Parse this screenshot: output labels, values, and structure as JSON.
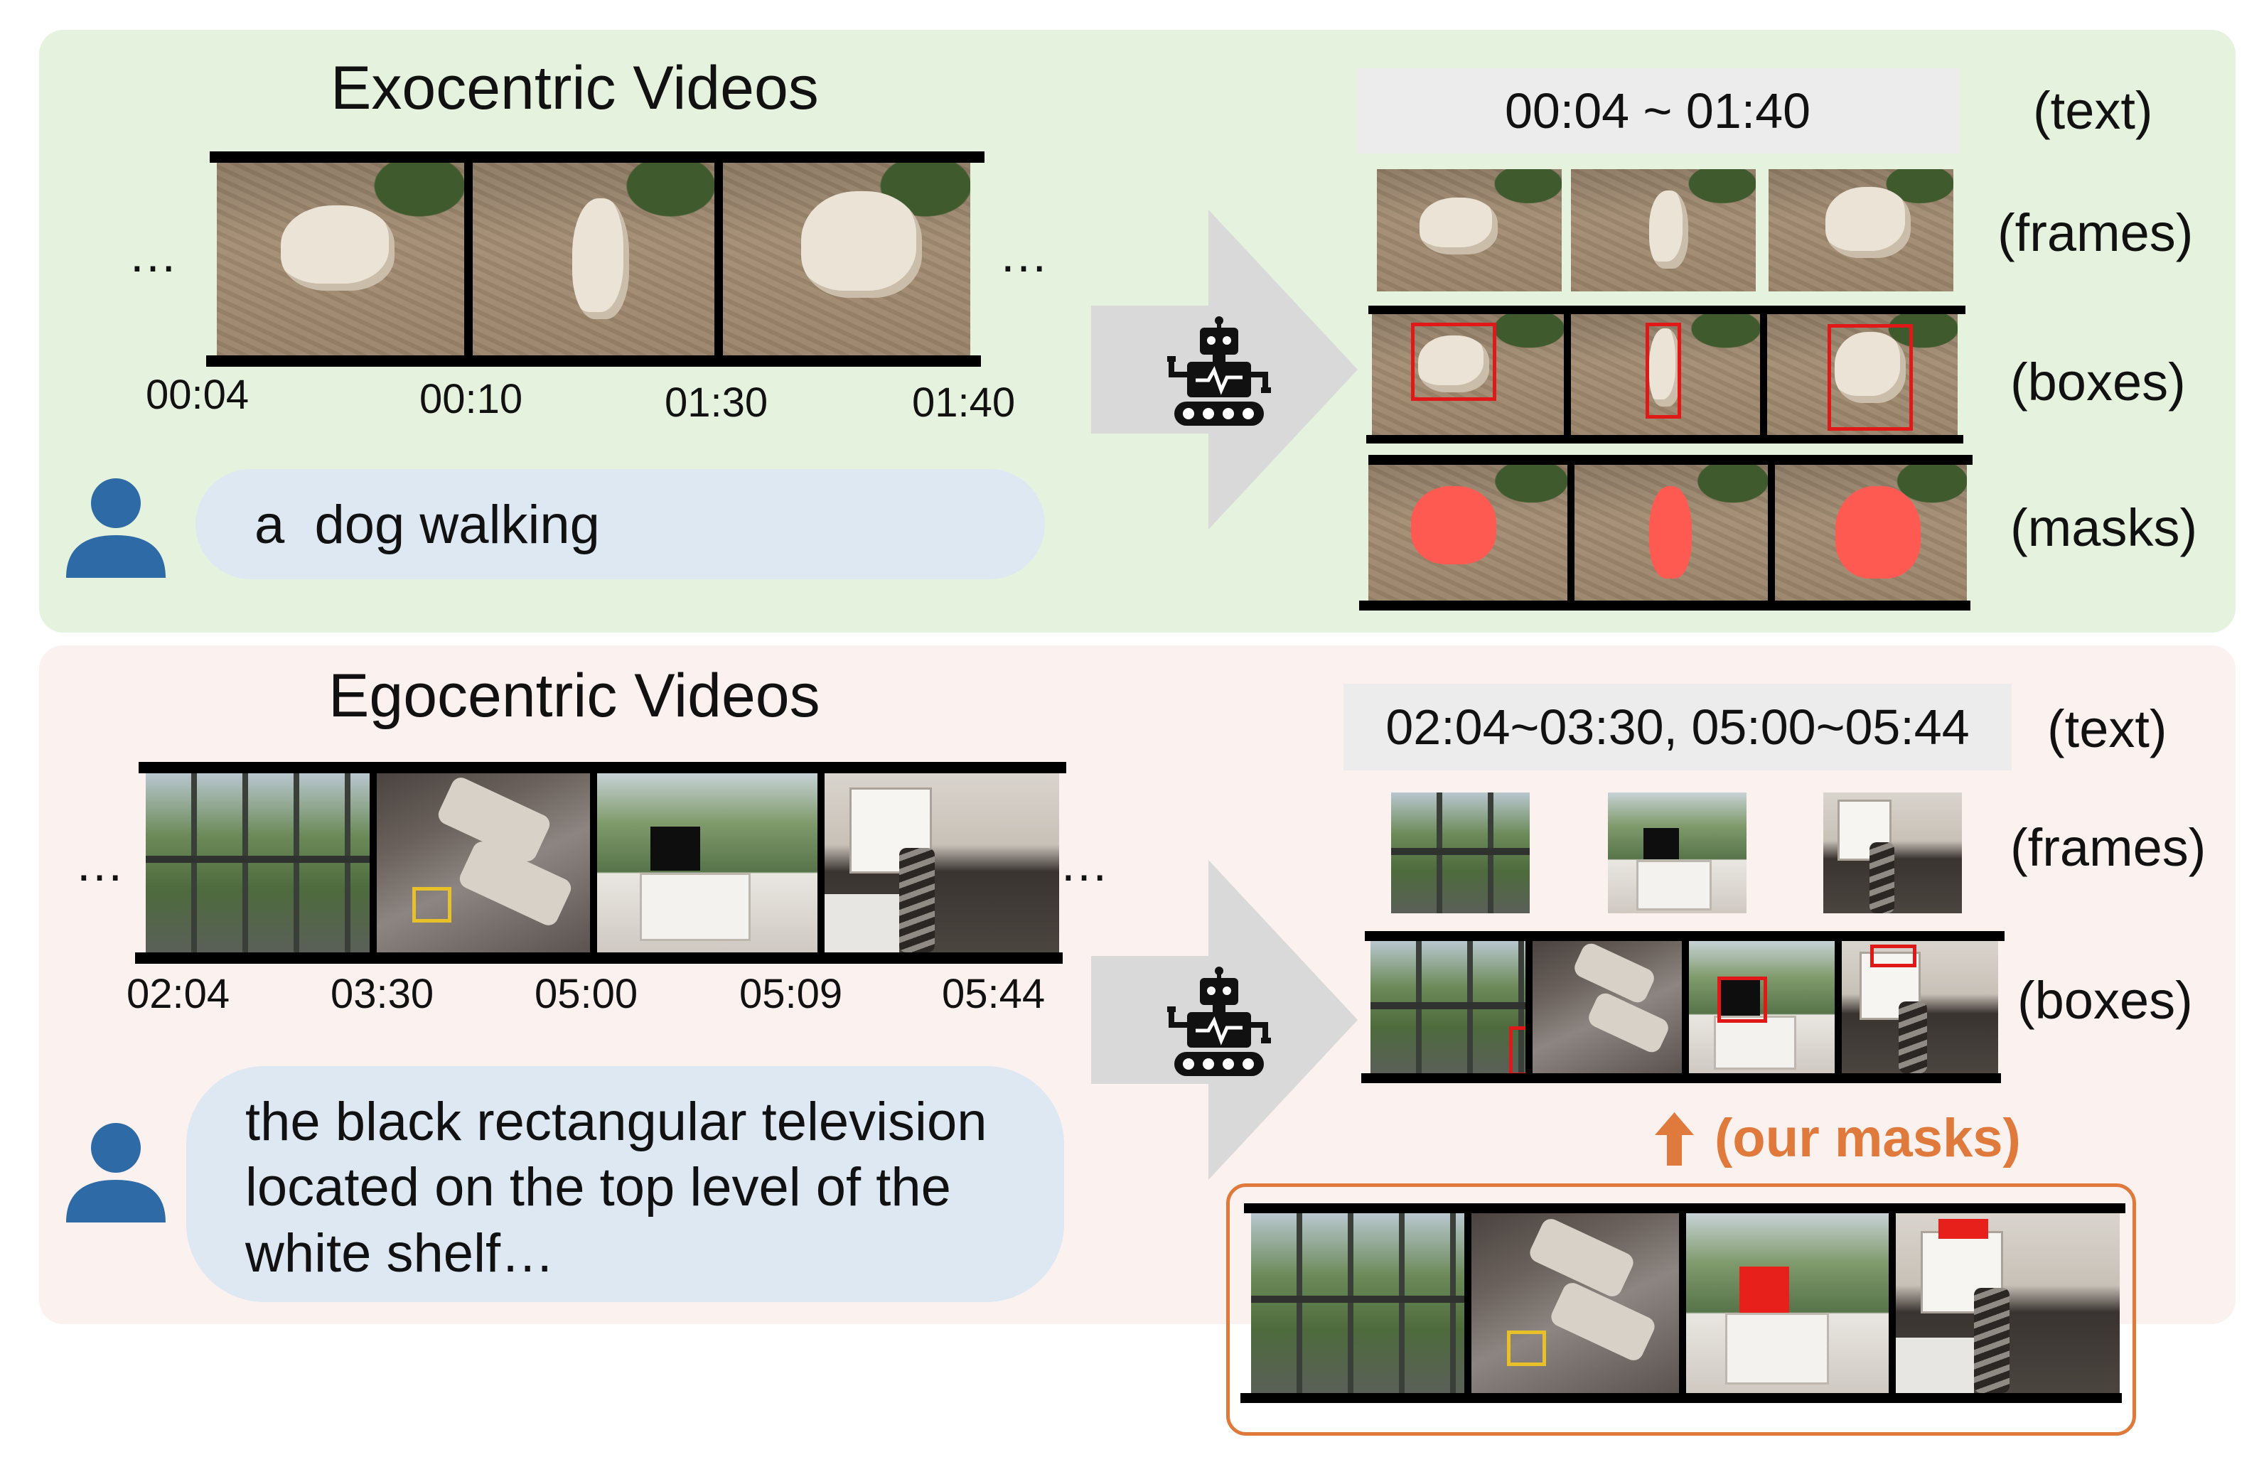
{
  "exo": {
    "title": "Exocentric Videos",
    "ellipsis": "…",
    "timestamps": [
      "00:04",
      "00:10",
      "01:30",
      "01:40"
    ],
    "query": "a  dog walking",
    "output_text": "00:04 ~ 01:40",
    "labels": {
      "text": "(text)",
      "frames": "(frames)",
      "boxes": "(boxes)",
      "masks": "(masks)"
    }
  },
  "ego": {
    "title": "Egocentric Videos",
    "ellipsis": "…",
    "timestamps": [
      "02:04",
      "03:30",
      "05:00",
      "05:09",
      "05:44"
    ],
    "query_lines": [
      "the black rectangular television",
      "located on the top level of the",
      "white shelf…"
    ],
    "output_text": "02:04~03:30, 05:00~05:44",
    "labels": {
      "text": "(text)",
      "frames": "(frames)",
      "boxes": "(boxes)"
    },
    "our_masks": "(our masks)"
  },
  "colors": {
    "exo_panel": "#e5f3de",
    "ego_panel": "#fbf1ee",
    "bubble": "#dde8f3",
    "user_icon": "#2e6aa5",
    "accent_orange": "#e07a3c",
    "mask_red": "#ff5a52",
    "box_red": "#e01818"
  },
  "icons": [
    "user-icon",
    "robot-icon",
    "right-arrow",
    "up-arrow-icon"
  ]
}
